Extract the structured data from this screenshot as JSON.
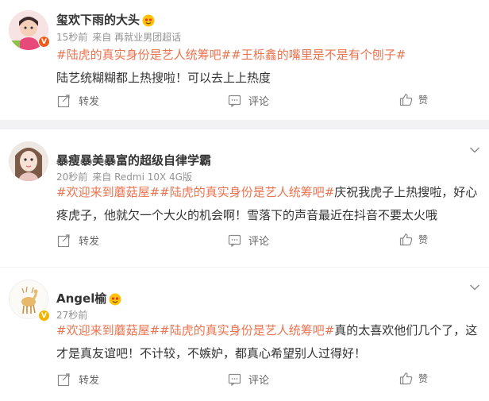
{
  "posts": [
    {
      "username": "玺欢下雨的大头",
      "time": "15秒前",
      "source": "来自 再就业男团超话",
      "content_parts": [
        {
          "text": "#陆虎的真实身份是艺人统筹吧##王栎鑫的嘴里是不是有个刨子#",
          "tag": true
        },
        {
          "text": "陆艺统糊糊都上热搜啦！可以去上上热度",
          "tag": false
        }
      ],
      "badge_color": "#f05a1a",
      "badge_letter": "V"
    },
    {
      "username": "暴瘦暴美暴富的超级自律学霸",
      "time": "20秒前",
      "source": "来自 Redmi 10X 4G版",
      "content_parts": [
        {
          "text": "#欢迎来到蘑菇屋##陆虎的真实身份是艺人统筹吧#",
          "tag": true
        },
        {
          "text": "庆祝我虎子上热搜啦，好心疼虎子，他就欠一个大火的机会啊！雪落下的声音最近在抖音不要太火哦",
          "tag": false
        }
      ]
    },
    {
      "username": "Angel榆",
      "time": "27秒前",
      "source": "",
      "content_parts": [
        {
          "text": "#欢迎来到蘑菇屋##陆虎的真实身份是艺人统筹吧#",
          "tag": true
        },
        {
          "text": "真的太喜欢他们几个了，这才是真友谊吧！不计较，不嫉妒，都真心希望别人过得好！",
          "tag": false
        }
      ],
      "badge_color": "#f3b400",
      "badge_letter": "V"
    }
  ],
  "actions": {
    "repost": "转发",
    "comment": "评论",
    "like": "赞"
  },
  "colors": {
    "tag": "#eb7350",
    "meta": "#939393",
    "background": "#f2f2f5"
  }
}
